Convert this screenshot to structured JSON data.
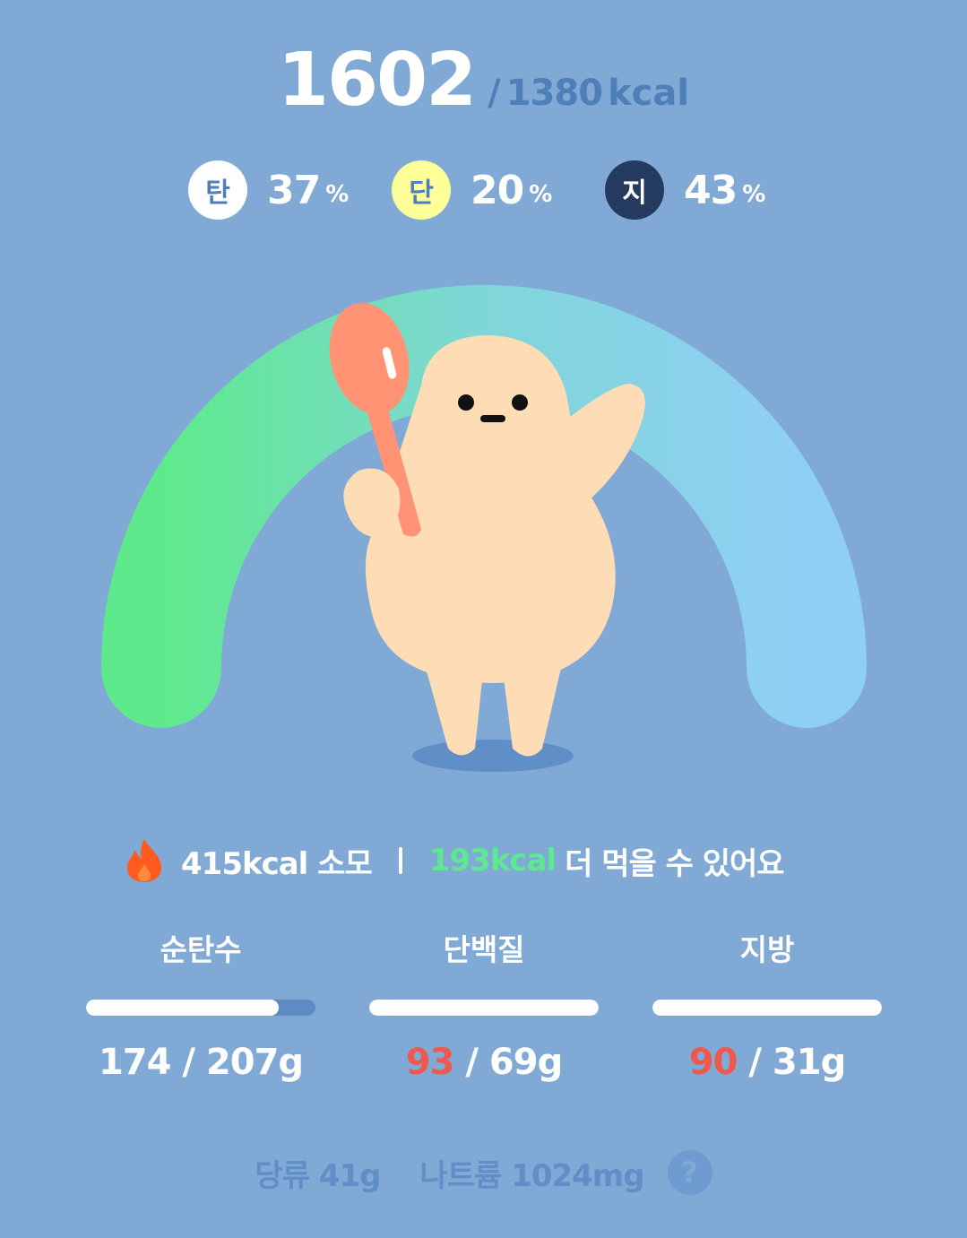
{
  "summary": {
    "calories_eaten": "1602",
    "slash": "/",
    "calories_goal": "1380",
    "calories_unit": "kcal"
  },
  "ratios": [
    {
      "badge": "탄",
      "value": "37",
      "unit": "%",
      "badge_bg": "#FFFFFF",
      "badge_fg": "#4F7FB8"
    },
    {
      "badge": "단",
      "value": "20",
      "unit": "%",
      "badge_bg": "#FFFF99",
      "badge_fg": "#4F7FB8"
    },
    {
      "badge": "지",
      "value": "43",
      "unit": "%",
      "badge_bg": "#243A5E",
      "badge_fg": "#FFFFFF"
    }
  ],
  "gauge": {
    "start_color": "#5EEA8C",
    "end_color": "#90CFF5",
    "mascot_icon": "spoon-character-icon"
  },
  "activity": {
    "burned": "415kcal 소모",
    "remaining_value": "193kcal",
    "remaining_text": "더 먹을 수 있어요",
    "burn_icon": "fire-icon"
  },
  "nutrients": [
    {
      "label": "순탄수",
      "current": "174",
      "sep": " / ",
      "goal": "207g",
      "progress": 0.84,
      "over": false
    },
    {
      "label": "단백질",
      "current": "93",
      "sep": " / ",
      "goal": "69g",
      "progress": 1.0,
      "over": true
    },
    {
      "label": "지방",
      "current": "90",
      "sep": " / ",
      "goal": "31g",
      "progress": 1.0,
      "over": true
    }
  ],
  "extras": {
    "sugar": "당류 41g",
    "sodium": "나트륨 1024mg",
    "help_icon": "question-icon",
    "help_label": "?"
  },
  "colors": {
    "background": "#80A9D5",
    "accent_dark": "#4F7FB8",
    "over_limit": "#F0584E",
    "remaining_green": "#5EE88F"
  }
}
